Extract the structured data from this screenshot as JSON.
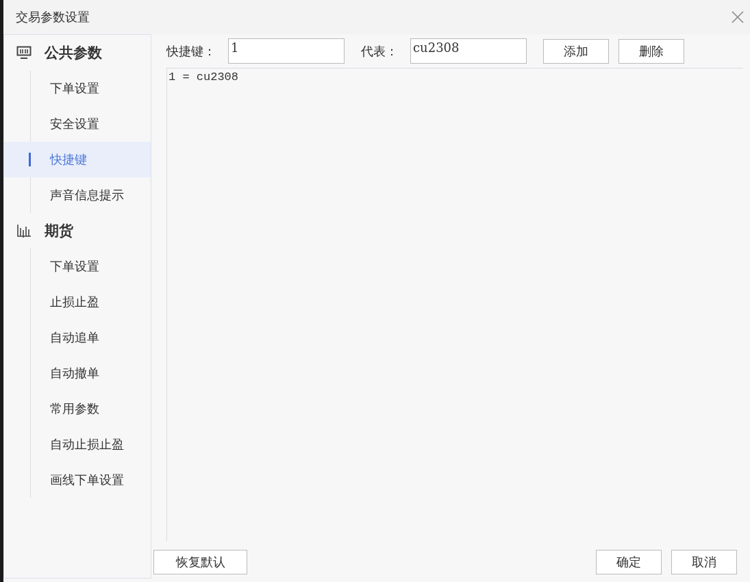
{
  "window": {
    "title": "交易参数设置"
  },
  "sidebar": {
    "groups": [
      {
        "label": "公共参数",
        "items": [
          {
            "label": "下单设置",
            "selected": false
          },
          {
            "label": "安全设置",
            "selected": false
          },
          {
            "label": "快捷键",
            "selected": true
          },
          {
            "label": "声音信息提示",
            "selected": false
          }
        ]
      },
      {
        "label": "期货",
        "items": [
          {
            "label": "下单设置",
            "selected": false
          },
          {
            "label": "止损止盈",
            "selected": false
          },
          {
            "label": "自动追单",
            "selected": false
          },
          {
            "label": "自动撤单",
            "selected": false
          },
          {
            "label": "常用参数",
            "selected": false
          },
          {
            "label": "自动止损止盈",
            "selected": false
          },
          {
            "label": "画线下单设置",
            "selected": false
          }
        ]
      }
    ]
  },
  "form": {
    "fields": [
      {
        "label": "快捷键：",
        "value": "1"
      },
      {
        "label": "代表：",
        "value": "cu2308"
      }
    ],
    "buttons": [
      "添加",
      "删除"
    ]
  },
  "list": {
    "lines": [
      "1 = cu2308"
    ]
  },
  "footer": {
    "left_buttons": [
      "恢复默认"
    ],
    "right_buttons": [
      "确定",
      "取消"
    ]
  }
}
